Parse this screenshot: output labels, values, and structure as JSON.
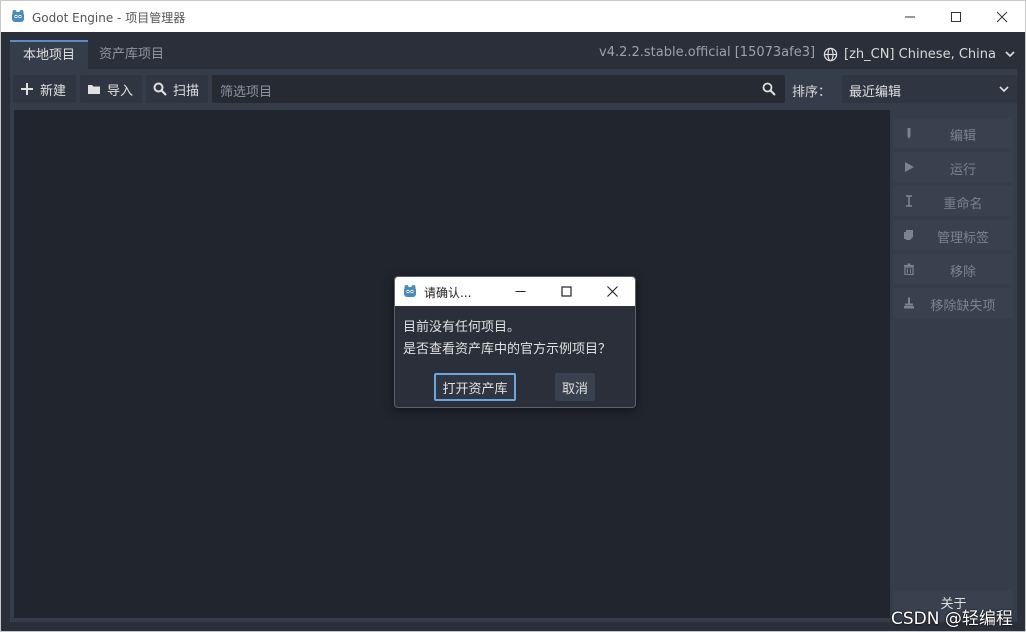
{
  "window": {
    "title": "Godot Engine - 项目管理器"
  },
  "tabs": [
    {
      "label": "本地项目",
      "active": true
    },
    {
      "label": "资产库项目",
      "active": false
    }
  ],
  "version": "v4.2.2.stable.official [15073afe3]",
  "language": "[zh_CN] Chinese, China",
  "toolbar": {
    "new_label": "新建",
    "import_label": "导入",
    "scan_label": "扫描",
    "filter_placeholder": "筛选项目",
    "sort_label": "排序：",
    "sort_value": "最近编辑"
  },
  "sidebar": {
    "items": [
      {
        "label": "编辑",
        "icon": "edit-icon"
      },
      {
        "label": "运行",
        "icon": "play-icon"
      },
      {
        "label": "重命名",
        "icon": "rename-icon"
      },
      {
        "label": "管理标签",
        "icon": "tag-icon"
      },
      {
        "label": "移除",
        "icon": "trash-icon"
      },
      {
        "label": "移除缺失项",
        "icon": "broom-icon"
      }
    ],
    "about_label": "关于"
  },
  "dialog": {
    "title": "请确认...",
    "message_line1": "目前没有任何项目。",
    "message_line2": "是否查看资产库中的官方示例项目？",
    "ok_label": "打开资产库",
    "cancel_label": "取消"
  },
  "watermark": "CSDN @轻编程",
  "colors": {
    "accent": "#5e88c6",
    "background": "#2b2f3a",
    "panel": "#363d4a",
    "list": "#21252d"
  }
}
